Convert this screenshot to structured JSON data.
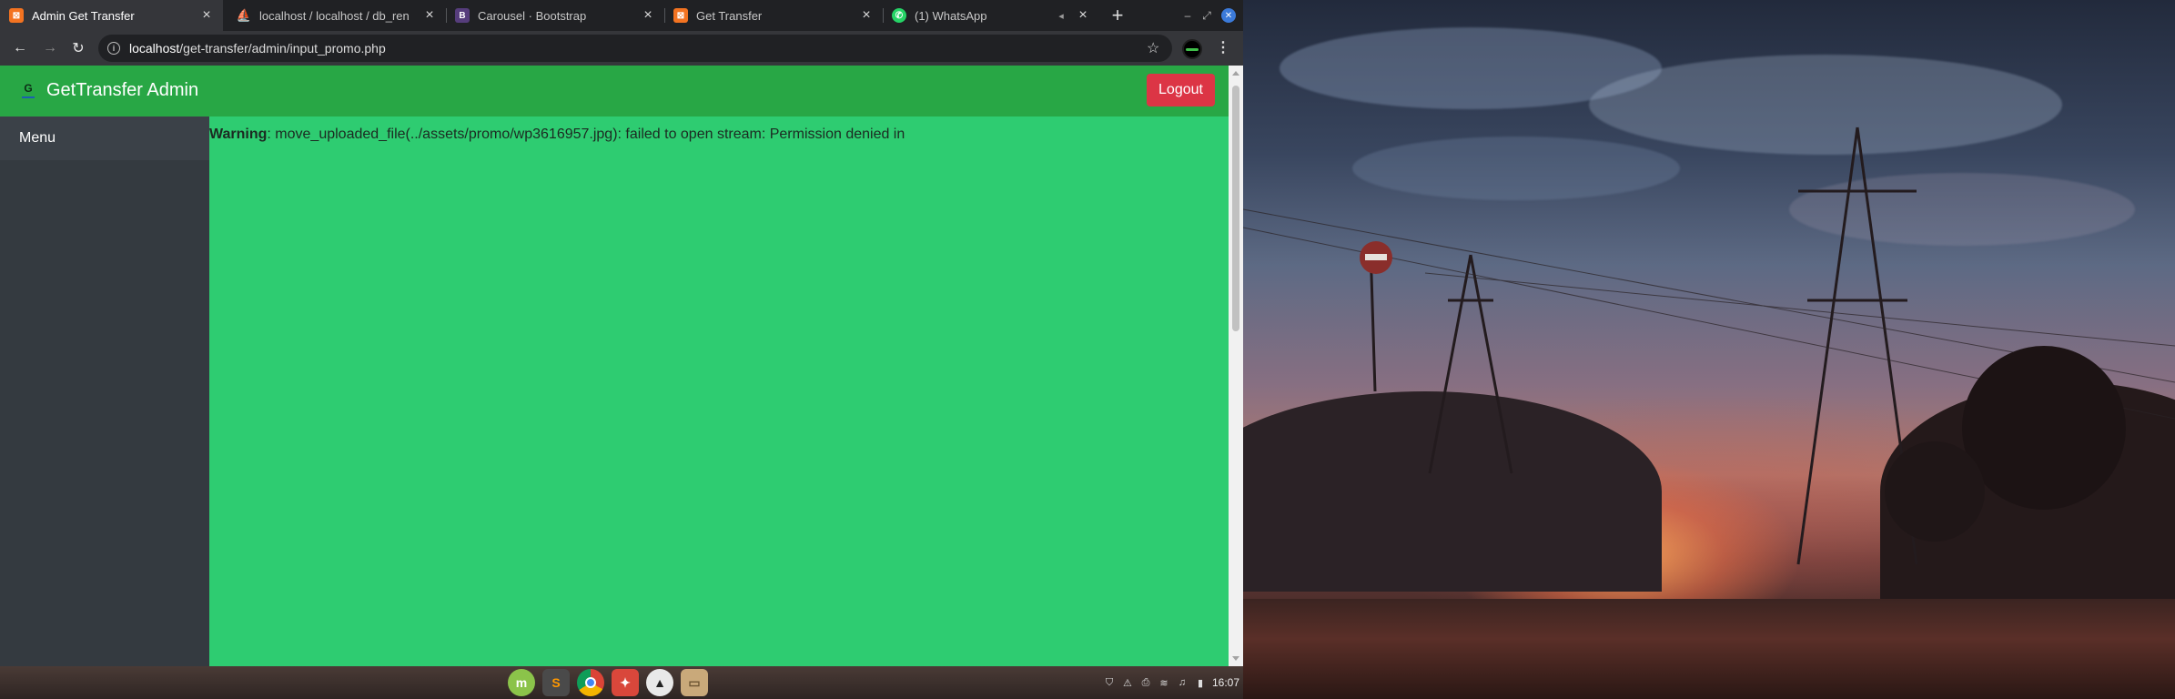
{
  "browser": {
    "tabs": [
      {
        "title": "Admin Get Transfer",
        "favicon": "xampp-icon",
        "favicon_color": "#f37321",
        "active": true
      },
      {
        "title": "localhost / localhost / db_ren",
        "favicon": "phpmyadmin-icon",
        "favicon_color": "#f89c0e",
        "active": false
      },
      {
        "title": "Carousel · Bootstrap",
        "favicon": "bootstrap-icon",
        "favicon_color": "#563d7c",
        "active": false
      },
      {
        "title": "Get Transfer",
        "favicon": "xampp-icon",
        "favicon_color": "#f37321",
        "active": false
      },
      {
        "title": "(1) WhatsApp",
        "favicon": "whatsapp-icon",
        "favicon_color": "#25d366",
        "active": false
      }
    ],
    "url_host": "localhost",
    "url_path": "/get-transfer/admin/input_promo.php"
  },
  "app": {
    "brand_name": "GetTransfer Admin",
    "brand_logo_letter": "G",
    "logout_label": "Logout",
    "logout_color": "#dc3545",
    "header_color": "#28a745",
    "body_color": "#2ecc71",
    "sidebar_color": "#343a40",
    "sidebar_title": "Menu",
    "warning_label": "Warning",
    "warning_message": ": move_uploaded_file(../assets/promo/wp3616957.jpg): failed to open stream: Permission denied in"
  },
  "taskbar": {
    "launchers": [
      "mint-menu-icon",
      "sublime-text-icon",
      "chrome-icon",
      "app-icon",
      "inkscape-icon",
      "folder-icon"
    ],
    "clock": "16:07"
  }
}
